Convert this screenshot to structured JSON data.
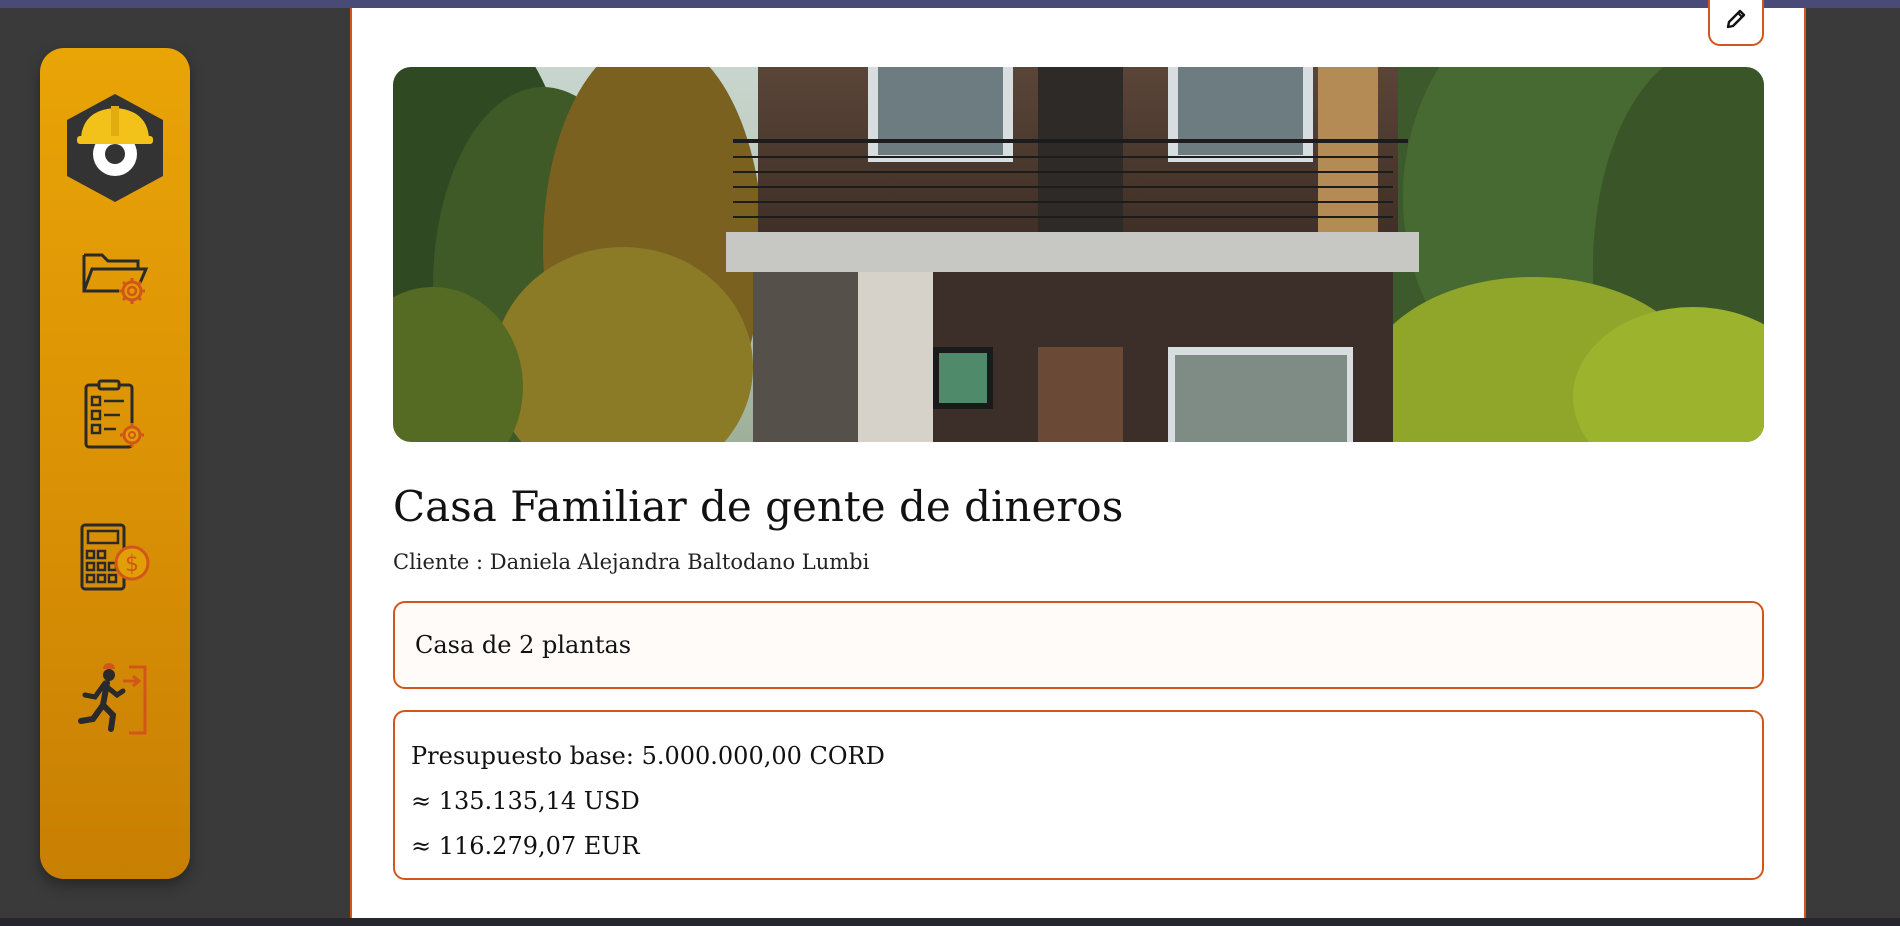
{
  "colors": {
    "accent": "#d2561a",
    "sidebar_top": "#e9a406",
    "sidebar_bottom": "#c87f03",
    "background": "#3a3a3a"
  },
  "sidebar": {
    "items": [
      {
        "icon": "hardhat-logo-icon"
      },
      {
        "icon": "folder-gear-icon"
      },
      {
        "icon": "clipboard-gear-icon"
      },
      {
        "icon": "calculator-dollar-icon"
      },
      {
        "icon": "exit-runner-icon"
      }
    ]
  },
  "toolbar": {
    "edit_icon": "pencil-icon"
  },
  "project": {
    "title": "Casa Familiar de gente de dineros",
    "client": "Cliente : Daniela Alejandra Baltodano Lumbi",
    "description": "Casa de 2 plantas",
    "budget": {
      "base": "Presupuesto base: 5.000.000,00 CORD",
      "usd": "≈ 135.135,14 USD",
      "eur": "≈ 116.279,07 EUR"
    }
  }
}
